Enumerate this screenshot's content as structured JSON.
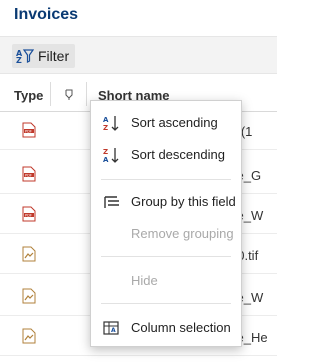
{
  "page": {
    "title": "Invoices"
  },
  "toolbar": {
    "filter_label": "Filter"
  },
  "grid": {
    "columns": {
      "type": "Type",
      "short_name": "Short name"
    },
    "rows": [
      {
        "type": "pdf",
        "short_name": "th(1"
      },
      {
        "type": "pdf",
        "short_name": "ce_G"
      },
      {
        "type": "pdf",
        "short_name": "ce_W"
      },
      {
        "type": "tif",
        "short_name": "30.tif"
      },
      {
        "type": "tif",
        "short_name": "ce_W"
      },
      {
        "type": "tif",
        "short_name": "ce_He"
      }
    ]
  },
  "context_menu": {
    "items": [
      {
        "label": "Sort ascending",
        "icon": "sort-ascending-icon",
        "enabled": true
      },
      {
        "label": "Sort descending",
        "icon": "sort-descending-icon",
        "enabled": true
      },
      {
        "label": "Group by this field",
        "icon": "group-icon",
        "enabled": true
      },
      {
        "label": "Remove grouping",
        "icon": "",
        "enabled": false
      },
      {
        "label": "Hide",
        "icon": "",
        "enabled": false
      },
      {
        "label": "Column selection",
        "icon": "column-selection-icon",
        "enabled": true
      }
    ]
  },
  "colors": {
    "title": "#0a3a73",
    "pdf_icon": "#c0392b",
    "tif_icon": "#b0813b"
  }
}
